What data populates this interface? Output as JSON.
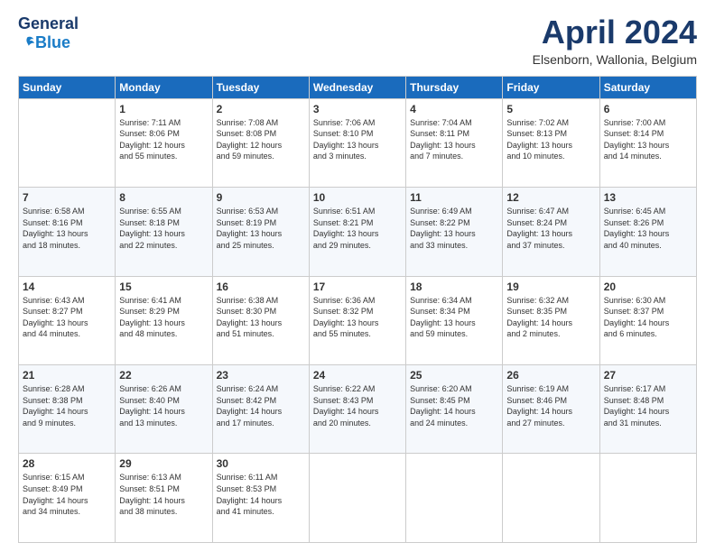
{
  "header": {
    "logo": {
      "part1": "General",
      "part2": "Blue"
    },
    "title": "April 2024",
    "location": "Elsenborn, Wallonia, Belgium"
  },
  "days_of_week": [
    "Sunday",
    "Monday",
    "Tuesday",
    "Wednesday",
    "Thursday",
    "Friday",
    "Saturday"
  ],
  "weeks": [
    [
      {
        "day": "",
        "info": ""
      },
      {
        "day": "1",
        "info": "Sunrise: 7:11 AM\nSunset: 8:06 PM\nDaylight: 12 hours\nand 55 minutes."
      },
      {
        "day": "2",
        "info": "Sunrise: 7:08 AM\nSunset: 8:08 PM\nDaylight: 12 hours\nand 59 minutes."
      },
      {
        "day": "3",
        "info": "Sunrise: 7:06 AM\nSunset: 8:10 PM\nDaylight: 13 hours\nand 3 minutes."
      },
      {
        "day": "4",
        "info": "Sunrise: 7:04 AM\nSunset: 8:11 PM\nDaylight: 13 hours\nand 7 minutes."
      },
      {
        "day": "5",
        "info": "Sunrise: 7:02 AM\nSunset: 8:13 PM\nDaylight: 13 hours\nand 10 minutes."
      },
      {
        "day": "6",
        "info": "Sunrise: 7:00 AM\nSunset: 8:14 PM\nDaylight: 13 hours\nand 14 minutes."
      }
    ],
    [
      {
        "day": "7",
        "info": "Sunrise: 6:58 AM\nSunset: 8:16 PM\nDaylight: 13 hours\nand 18 minutes."
      },
      {
        "day": "8",
        "info": "Sunrise: 6:55 AM\nSunset: 8:18 PM\nDaylight: 13 hours\nand 22 minutes."
      },
      {
        "day": "9",
        "info": "Sunrise: 6:53 AM\nSunset: 8:19 PM\nDaylight: 13 hours\nand 25 minutes."
      },
      {
        "day": "10",
        "info": "Sunrise: 6:51 AM\nSunset: 8:21 PM\nDaylight: 13 hours\nand 29 minutes."
      },
      {
        "day": "11",
        "info": "Sunrise: 6:49 AM\nSunset: 8:22 PM\nDaylight: 13 hours\nand 33 minutes."
      },
      {
        "day": "12",
        "info": "Sunrise: 6:47 AM\nSunset: 8:24 PM\nDaylight: 13 hours\nand 37 minutes."
      },
      {
        "day": "13",
        "info": "Sunrise: 6:45 AM\nSunset: 8:26 PM\nDaylight: 13 hours\nand 40 minutes."
      }
    ],
    [
      {
        "day": "14",
        "info": "Sunrise: 6:43 AM\nSunset: 8:27 PM\nDaylight: 13 hours\nand 44 minutes."
      },
      {
        "day": "15",
        "info": "Sunrise: 6:41 AM\nSunset: 8:29 PM\nDaylight: 13 hours\nand 48 minutes."
      },
      {
        "day": "16",
        "info": "Sunrise: 6:38 AM\nSunset: 8:30 PM\nDaylight: 13 hours\nand 51 minutes."
      },
      {
        "day": "17",
        "info": "Sunrise: 6:36 AM\nSunset: 8:32 PM\nDaylight: 13 hours\nand 55 minutes."
      },
      {
        "day": "18",
        "info": "Sunrise: 6:34 AM\nSunset: 8:34 PM\nDaylight: 13 hours\nand 59 minutes."
      },
      {
        "day": "19",
        "info": "Sunrise: 6:32 AM\nSunset: 8:35 PM\nDaylight: 14 hours\nand 2 minutes."
      },
      {
        "day": "20",
        "info": "Sunrise: 6:30 AM\nSunset: 8:37 PM\nDaylight: 14 hours\nand 6 minutes."
      }
    ],
    [
      {
        "day": "21",
        "info": "Sunrise: 6:28 AM\nSunset: 8:38 PM\nDaylight: 14 hours\nand 9 minutes."
      },
      {
        "day": "22",
        "info": "Sunrise: 6:26 AM\nSunset: 8:40 PM\nDaylight: 14 hours\nand 13 minutes."
      },
      {
        "day": "23",
        "info": "Sunrise: 6:24 AM\nSunset: 8:42 PM\nDaylight: 14 hours\nand 17 minutes."
      },
      {
        "day": "24",
        "info": "Sunrise: 6:22 AM\nSunset: 8:43 PM\nDaylight: 14 hours\nand 20 minutes."
      },
      {
        "day": "25",
        "info": "Sunrise: 6:20 AM\nSunset: 8:45 PM\nDaylight: 14 hours\nand 24 minutes."
      },
      {
        "day": "26",
        "info": "Sunrise: 6:19 AM\nSunset: 8:46 PM\nDaylight: 14 hours\nand 27 minutes."
      },
      {
        "day": "27",
        "info": "Sunrise: 6:17 AM\nSunset: 8:48 PM\nDaylight: 14 hours\nand 31 minutes."
      }
    ],
    [
      {
        "day": "28",
        "info": "Sunrise: 6:15 AM\nSunset: 8:49 PM\nDaylight: 14 hours\nand 34 minutes."
      },
      {
        "day": "29",
        "info": "Sunrise: 6:13 AM\nSunset: 8:51 PM\nDaylight: 14 hours\nand 38 minutes."
      },
      {
        "day": "30",
        "info": "Sunrise: 6:11 AM\nSunset: 8:53 PM\nDaylight: 14 hours\nand 41 minutes."
      },
      {
        "day": "",
        "info": ""
      },
      {
        "day": "",
        "info": ""
      },
      {
        "day": "",
        "info": ""
      },
      {
        "day": "",
        "info": ""
      }
    ]
  ]
}
